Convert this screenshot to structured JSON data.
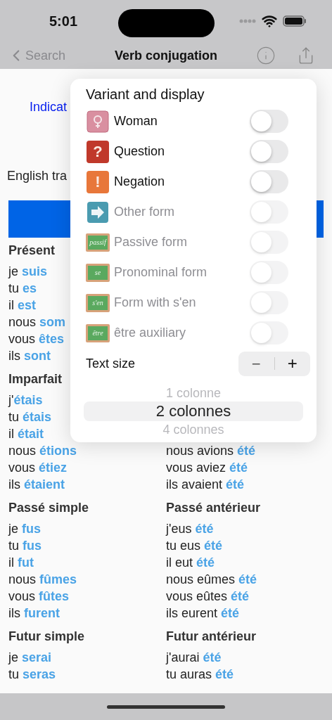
{
  "status_bar": {
    "time": "5:01"
  },
  "nav": {
    "back": "Search",
    "title": "Verb conjugation"
  },
  "content": {
    "mood": "Indicat",
    "translation": "English tra",
    "columns": [
      [
        {
          "title": "Présent",
          "rows": [
            {
              "subject": "je ",
              "verb": "suis"
            },
            {
              "subject": "tu ",
              "verb": "es"
            },
            {
              "subject": "il ",
              "verb": "est"
            },
            {
              "subject": "nous ",
              "verb": "som"
            },
            {
              "subject": "vous ",
              "verb": "êtes"
            },
            {
              "subject": "ils ",
              "verb": "sont"
            }
          ]
        },
        {
          "title": "Imparfait",
          "rows": [
            {
              "subject": "j'",
              "verb": "étais"
            },
            {
              "subject": "tu ",
              "verb": "étais"
            },
            {
              "subject": "il ",
              "verb": "était"
            },
            {
              "subject": "nous ",
              "verb": "étions"
            },
            {
              "subject": "vous ",
              "verb": "étiez"
            },
            {
              "subject": "ils ",
              "verb": "étaient"
            }
          ]
        },
        {
          "title": "Passé simple",
          "rows": [
            {
              "subject": "je ",
              "verb": "fus"
            },
            {
              "subject": "tu ",
              "verb": "fus"
            },
            {
              "subject": "il ",
              "verb": "fut"
            },
            {
              "subject": "nous ",
              "verb": "fûmes"
            },
            {
              "subject": "vous ",
              "verb": "fûtes"
            },
            {
              "subject": "ils ",
              "verb": "furent"
            }
          ]
        },
        {
          "title": "Futur simple",
          "rows": [
            {
              "subject": "je ",
              "verb": "serai"
            },
            {
              "subject": "tu ",
              "verb": "seras"
            }
          ]
        }
      ],
      [
        {
          "rows": [
            {
              "subject": "nous avions ",
              "verb": "été"
            },
            {
              "subject": "vous aviez ",
              "verb": "été"
            },
            {
              "subject": "ils avaient ",
              "verb": "été"
            }
          ]
        },
        {
          "title": "Passé antérieur",
          "rows": [
            {
              "subject": "j'eus ",
              "verb": "été"
            },
            {
              "subject": "tu eus ",
              "verb": "été"
            },
            {
              "subject": "il eut ",
              "verb": "été"
            },
            {
              "subject": "nous eûmes ",
              "verb": "été"
            },
            {
              "subject": "vous eûtes ",
              "verb": "été"
            },
            {
              "subject": "ils eurent ",
              "verb": "été"
            }
          ]
        },
        {
          "title": "Futur antérieur",
          "rows": [
            {
              "subject": "j'aurai ",
              "verb": "été"
            },
            {
              "subject": "tu auras ",
              "verb": "été"
            }
          ]
        }
      ]
    ]
  },
  "popover": {
    "title": "Variant and display",
    "options": [
      {
        "kind": "female",
        "label": "Woman",
        "on": false,
        "disabled": false
      },
      {
        "kind": "glyph",
        "glyph": "?",
        "color": "#c0392b",
        "label": "Question",
        "on": false,
        "disabled": false
      },
      {
        "kind": "glyph",
        "glyph": "!",
        "color": "#e8773a",
        "label": "Negation",
        "on": false,
        "disabled": false
      },
      {
        "kind": "arrow",
        "label": "Other form",
        "on": false,
        "disabled": true
      },
      {
        "kind": "chalkboard",
        "board_text": "passif",
        "label": "Passive form",
        "on": false,
        "disabled": true
      },
      {
        "kind": "chalkboard",
        "board_text": "se",
        "label": "Pronominal form",
        "on": false,
        "disabled": true
      },
      {
        "kind": "chalkboard",
        "board_text": "s'en",
        "label": "Form with s'en",
        "on": false,
        "disabled": true
      },
      {
        "kind": "chalkboard",
        "board_text": "être",
        "label": "être auxiliary",
        "on": false,
        "disabled": true
      }
    ],
    "text_size": {
      "label": "Text size",
      "decrease": "−",
      "increase": "+"
    },
    "picker": [
      {
        "label": "1 colonne",
        "selected": false
      },
      {
        "label": "2 colonnes",
        "selected": true
      },
      {
        "label": "4 colonnes",
        "selected": false
      }
    ]
  }
}
